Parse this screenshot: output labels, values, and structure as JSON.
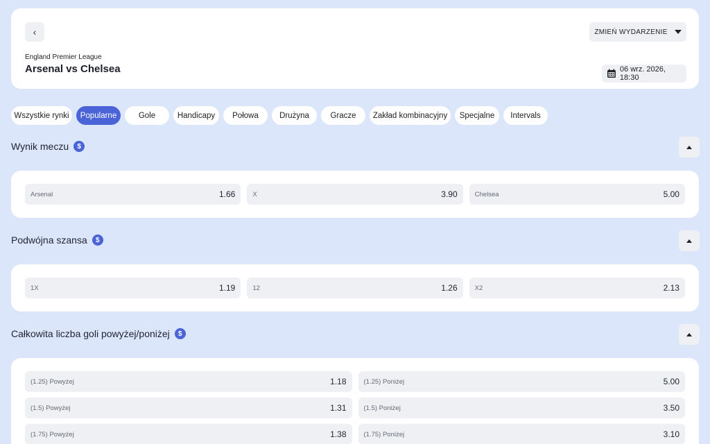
{
  "header": {
    "change_label": "ZMIEŃ WYDARZENIE",
    "league": "England Premier League",
    "match": "Arsenal vs Chelsea",
    "date": "06 wrz. 2026, 18:30"
  },
  "tabs": [
    {
      "label": "Wszystkie rynki"
    },
    {
      "label": "Popularne",
      "active": true
    },
    {
      "label": "Gole"
    },
    {
      "label": "Handicapy"
    },
    {
      "label": "Połowa"
    },
    {
      "label": "Drużyna"
    },
    {
      "label": "Gracze"
    },
    {
      "label": "Zakład kombinacyjny"
    },
    {
      "label": "Specjalne"
    },
    {
      "label": "Intervals"
    }
  ],
  "markets": {
    "match_result": {
      "title": "Wynik meczu",
      "odds": [
        {
          "label": "Arsenal",
          "value": "1.66"
        },
        {
          "label": "X",
          "value": "3.90"
        },
        {
          "label": "Chelsea",
          "value": "5.00"
        }
      ]
    },
    "double_chance": {
      "title": "Podwójna szansa",
      "odds": [
        {
          "label": "1X",
          "value": "1.19"
        },
        {
          "label": "12",
          "value": "1.26"
        },
        {
          "label": "X2",
          "value": "2.13"
        }
      ]
    },
    "total_goals": {
      "title": "Całkowita liczba goli powyżej/poniżej",
      "odds": [
        {
          "label": "(1.25) Powyżej",
          "value": "1.18"
        },
        {
          "label": "(1.25) Poniżej",
          "value": "5.00"
        },
        {
          "label": "(1.5) Powyżej",
          "value": "1.31"
        },
        {
          "label": "(1.5) Poniżej",
          "value": "3.50"
        },
        {
          "label": "(1.75) Powyżej",
          "value": "1.38"
        },
        {
          "label": "(1.75) Poniżej",
          "value": "3.10"
        }
      ]
    }
  },
  "icons": {
    "currency": "dollar-icon",
    "accent": "#4a63d6"
  }
}
